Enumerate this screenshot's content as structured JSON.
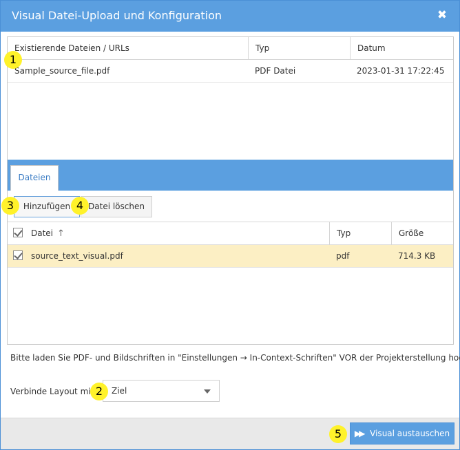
{
  "dialog": {
    "title": "Visual Datei-Upload und Konfiguration",
    "close_icon": "close-icon"
  },
  "existing": {
    "headers": [
      "Existierende Dateien / URLs",
      "Typ",
      "Datum"
    ],
    "rows": [
      {
        "name": "Sample_source_file.pdf",
        "type": "PDF Datei",
        "date": "2023-01-31 17:22:45"
      }
    ]
  },
  "tabs": {
    "files": "Dateien"
  },
  "buttons": {
    "add": "Hinzufügen",
    "delete": "Datei löschen"
  },
  "grid": {
    "headers": {
      "name": "Datei",
      "type": "Typ",
      "size": "Größe"
    },
    "sort_icon": "sort-ascending-icon",
    "rows": [
      {
        "name": "source_text_visual.pdf",
        "type": "pdf",
        "size": "714.3 KB",
        "checked": true
      }
    ]
  },
  "hint": "Bitte laden Sie PDF- und Bildschriften in \"Einstellungen → In-Context-Schriften\" VOR der Projekterstellung hoch",
  "layout": {
    "label": "Verbinde Layout mit",
    "selected": "Ziel"
  },
  "footer": {
    "replace_label": "Visual austauschen"
  },
  "markers": [
    "1",
    "2",
    "3",
    "4",
    "5"
  ],
  "colors": {
    "accent": "#5b9fe0",
    "selected_row": "#fcefc4",
    "marker": "#fff22a"
  }
}
